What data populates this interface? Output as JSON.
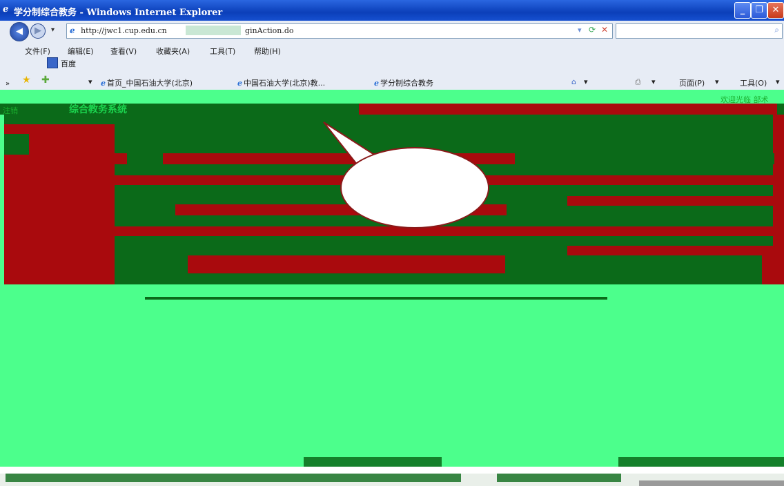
{
  "window": {
    "title": "学分制综合教务 - Windows Internet Explorer",
    "minimize_glyph": "_",
    "restore_glyph": "❐",
    "close_glyph": "✕"
  },
  "navbar": {
    "back_glyph": "◀",
    "forward_glyph": "▶",
    "dropdown_glyph": "▾",
    "address": "http://jwc1.cup.edu.cn",
    "address_suffix": "ginAction.do",
    "refresh_glyph": "⟳",
    "stop_glyph": "✕",
    "search_glyph": "⌕"
  },
  "menu": {
    "items": [
      "文件(F)",
      "编辑(E)",
      "查看(V)",
      "收藏夹(A)",
      "工具(T)",
      "帮助(H)"
    ]
  },
  "links_bar": {
    "baidu_label": "百度"
  },
  "favorites": {
    "overflow": "»",
    "items": [
      "首页_中国石油大学(北京)",
      "中国石油大学(北京)教...",
      "学分制综合教务"
    ],
    "page_menu": "页面(P)",
    "tools_menu": "工具(O)"
  },
  "page": {
    "system_title": "综合教务系统",
    "welcome": "欢迎光临 部术",
    "logout": "注销"
  },
  "colors": {
    "mint": "#4cff8c",
    "dark_red": "#a90a0d",
    "dark_green": "#0b6a19",
    "ie_blue": "#0b3fb9"
  }
}
